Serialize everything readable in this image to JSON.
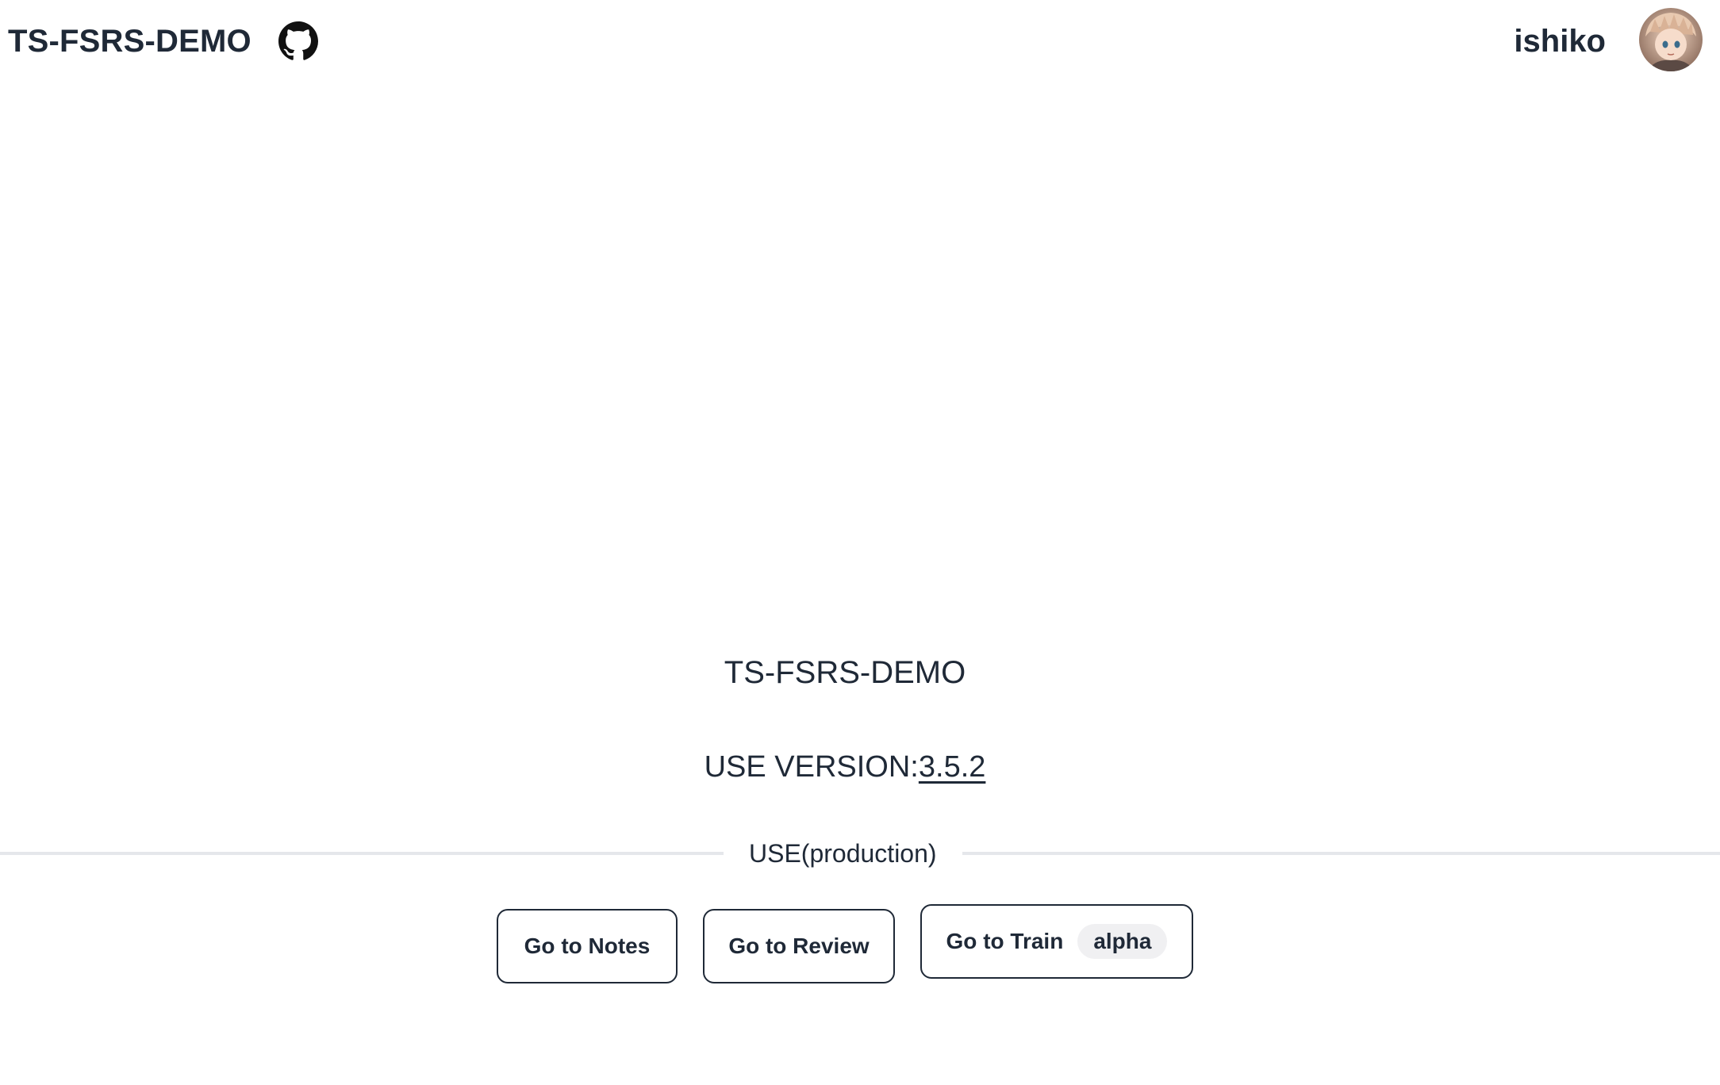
{
  "navbar": {
    "brand": "TS-FSRS-DEMO",
    "github_icon": "github-icon",
    "username": "ishiko",
    "avatar_icon": "avatar-image"
  },
  "hero": {
    "title": "TS-FSRS-DEMO",
    "version_label": "USE VERSION:",
    "version_value": "3.5.2"
  },
  "divider": {
    "label": "USE(production)"
  },
  "actions": {
    "notes_label": "Go to Notes",
    "review_label": "Go to Review",
    "train_label": "Go to Train",
    "train_badge": "alpha"
  },
  "colors": {
    "text": "#1f2937",
    "divider": "#e5e7eb",
    "badge_bg": "#f0f0f2"
  }
}
